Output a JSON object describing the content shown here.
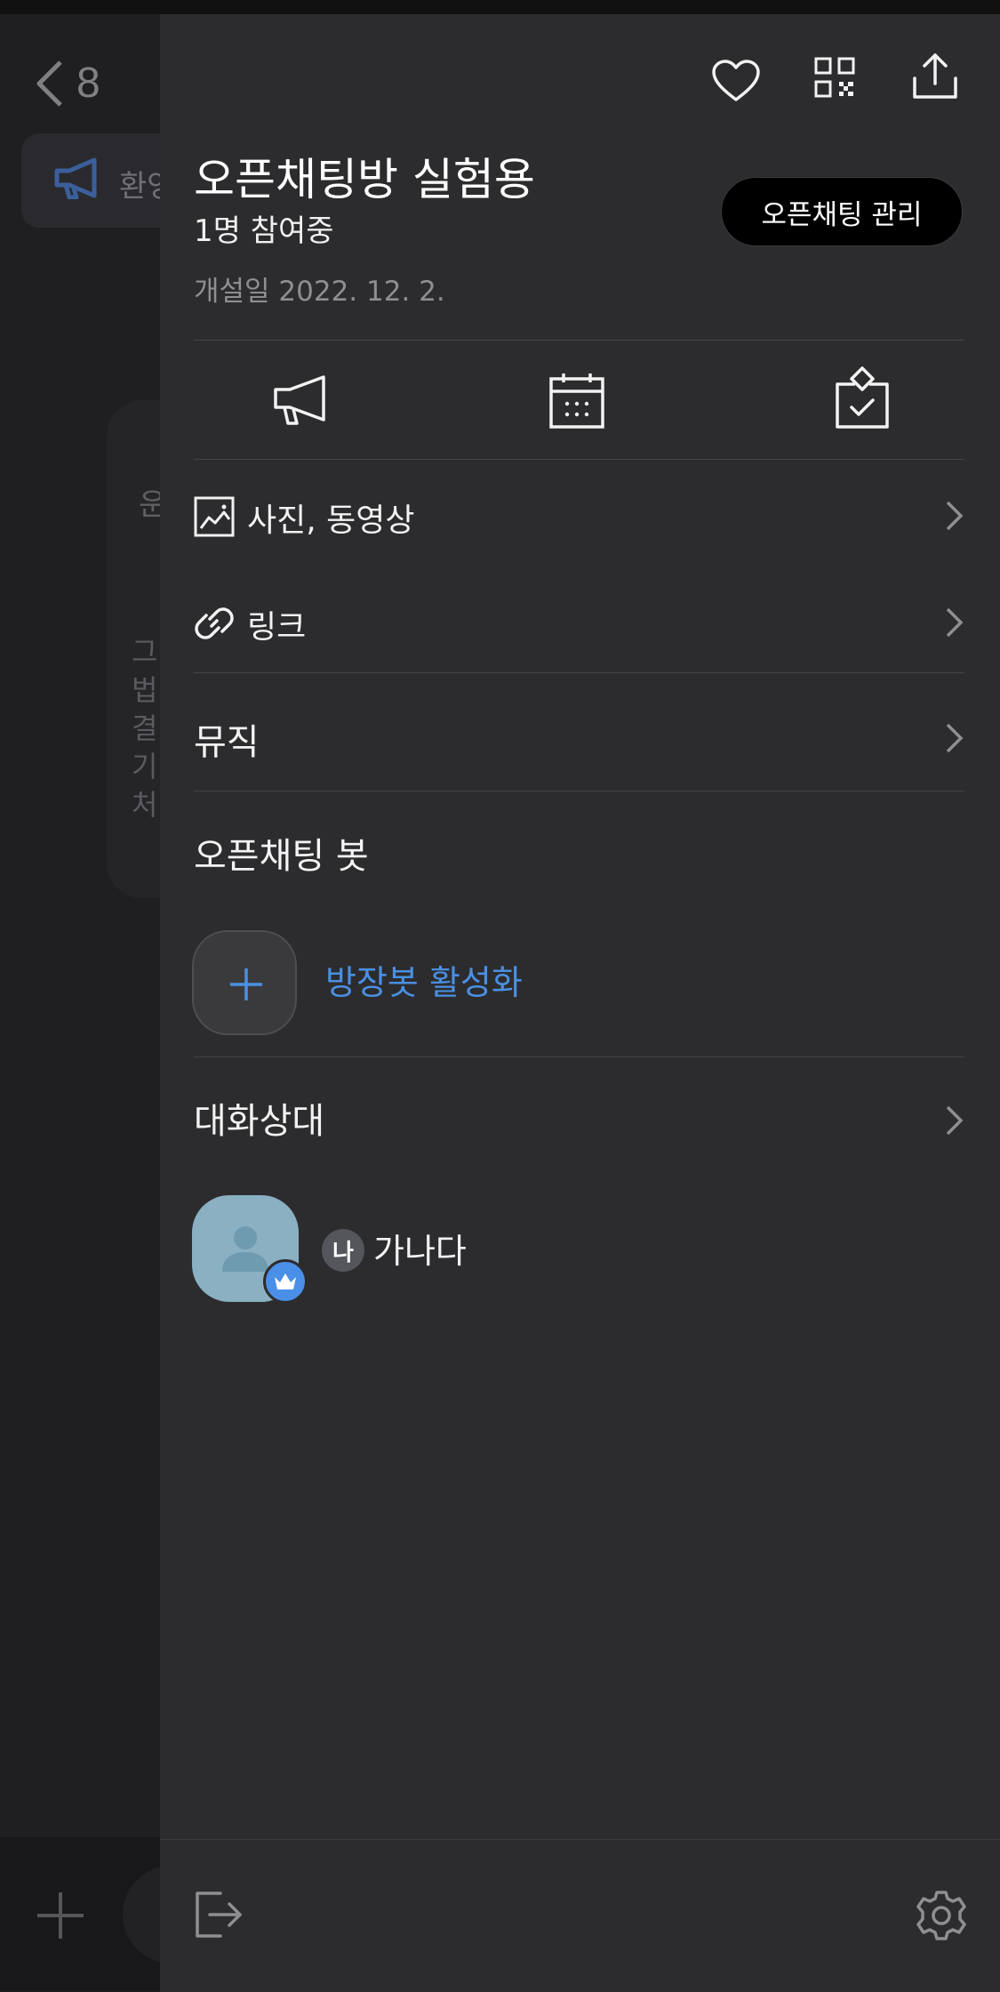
{
  "background": {
    "back_count": "8",
    "notice_snippet": "환영",
    "card_title_snippet": "운",
    "card_lines": [
      "그",
      "법",
      "결",
      "기",
      "처"
    ]
  },
  "drawer": {
    "title": "오픈채팅방 실험용",
    "participants": "1명 참여중",
    "created": "개설일 2022. 12. 2.",
    "manage_button": "오픈채팅 관리",
    "header_icons": [
      "heart-icon",
      "qr-code-icon",
      "share-icon"
    ],
    "quick_actions": [
      "notice-megaphone-icon",
      "calendar-icon",
      "vote-icon"
    ],
    "rows": {
      "media": "사진, 동영상",
      "links": "링크",
      "music": "뮤직"
    },
    "bot_section": {
      "title": "오픈채팅 봇",
      "activate_label": "방장봇 활성화"
    },
    "members_section": {
      "title": "대화상대",
      "members": [
        {
          "me_badge": "나",
          "name": "가나다",
          "role": "host"
        }
      ]
    },
    "footer_icons": [
      "exit-icon",
      "settings-gear-icon"
    ]
  },
  "colors": {
    "drawer_bg": "#2c2c2e",
    "accent_blue": "#4a90e2",
    "avatar_bg": "#8ab0c2"
  }
}
